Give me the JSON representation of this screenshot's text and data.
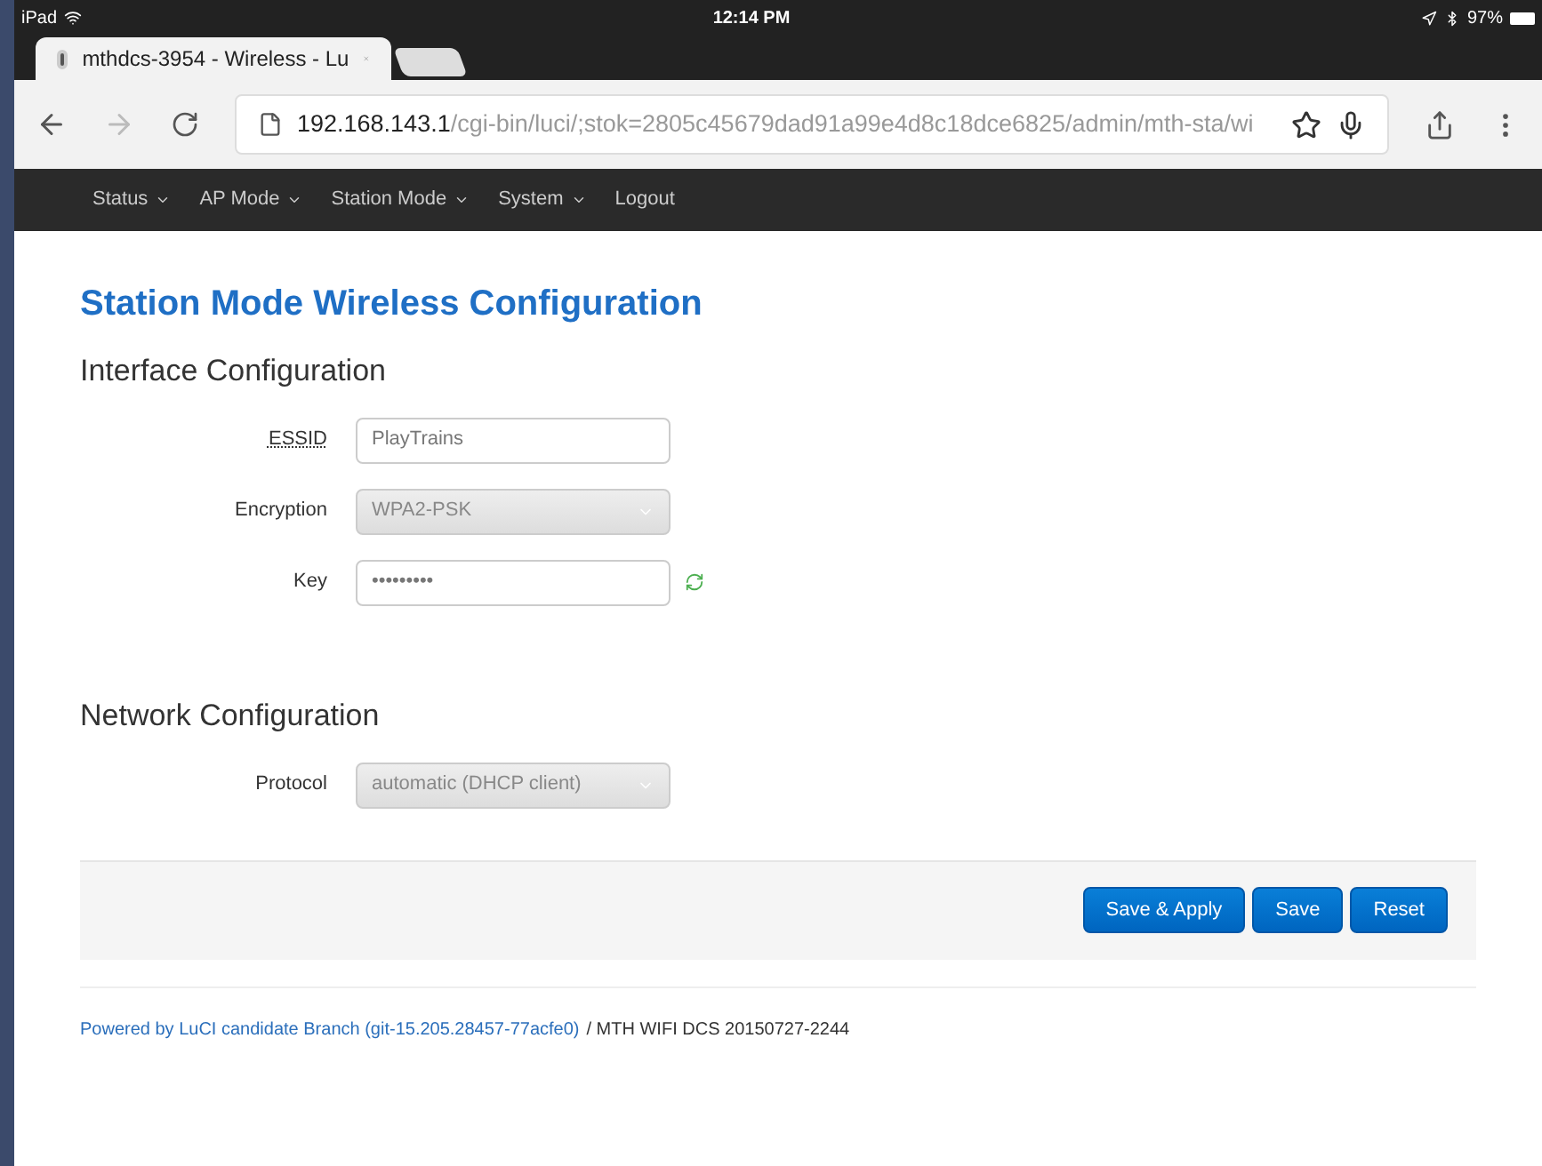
{
  "status_bar": {
    "device": "iPad",
    "time": "12:14 PM",
    "battery": "97%"
  },
  "browser": {
    "tabs": [
      {
        "title": "mthdcs-3954 - Wireless - Lu",
        "selected": true
      }
    ],
    "url_host": "192.168.143.1",
    "url_path": "/cgi-bin/luci/;stok=2805c45679dad91a99e4d8c18dce6825/admin/mth-sta/wi"
  },
  "nav": [
    {
      "label": "Status",
      "dropdown": true
    },
    {
      "label": "AP Mode",
      "dropdown": true
    },
    {
      "label": "Station Mode",
      "dropdown": true
    },
    {
      "label": "System",
      "dropdown": true
    },
    {
      "label": "Logout",
      "dropdown": false
    }
  ],
  "page_title": "Station Mode Wireless Configuration",
  "sections": [
    {
      "title": "Interface Configuration",
      "fields": [
        {
          "kind": "text",
          "label": "ESSID",
          "value": "PlayTrains"
        },
        {
          "kind": "select",
          "label": "Encryption",
          "value": "WPA2-PSK"
        },
        {
          "kind": "password",
          "label": "Key",
          "value": "•••••••••"
        }
      ]
    },
    {
      "title": "Network Configuration",
      "fields": [
        {
          "kind": "select",
          "label": "Protocol",
          "value": "automatic (DHCP client)"
        }
      ]
    }
  ],
  "buttons": [
    "Save & Apply",
    "Save",
    "Reset"
  ],
  "footer": {
    "link": "Powered by LuCI candidate Branch (git-15.205.28457-77acfe0)",
    "text": "/ MTH WIFI DCS 20150727-2244"
  }
}
